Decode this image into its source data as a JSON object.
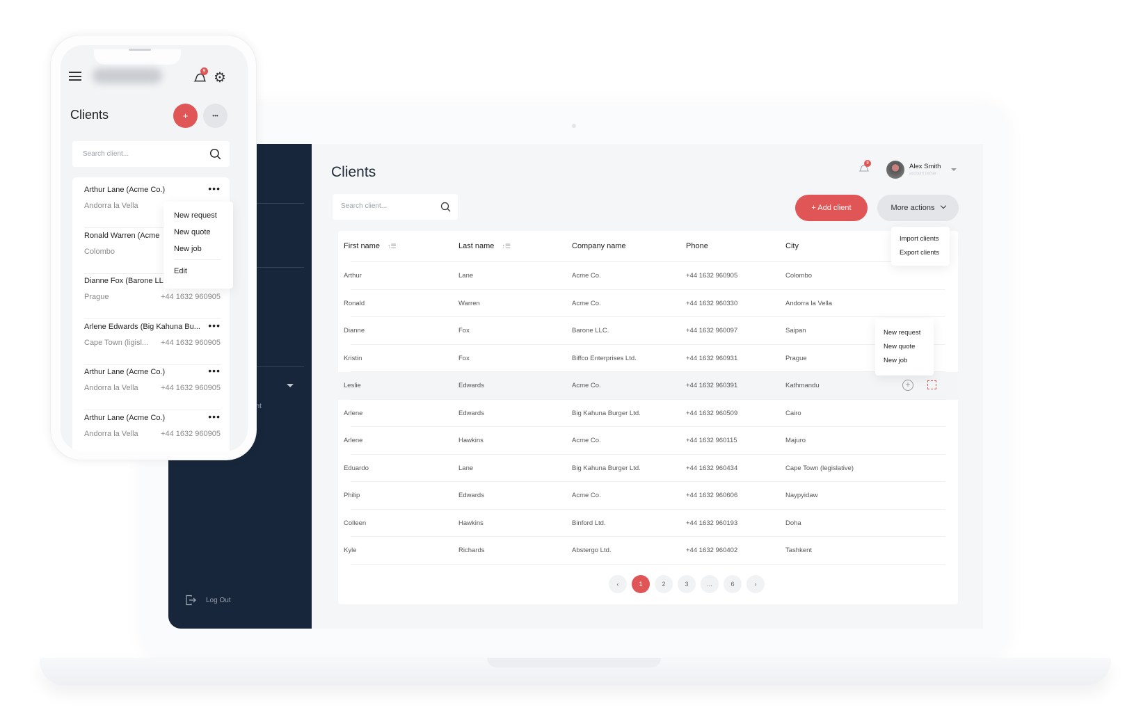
{
  "phone": {
    "notification_count": "9",
    "title": "Clients",
    "add_label": "+",
    "more_label": "•••",
    "search_placeholder": "Search client...",
    "items": [
      {
        "name": "Arthur Lane (Acme Co.)",
        "city": "Andorra la Vella",
        "phone": ""
      },
      {
        "name": "Ronald Warren (Acme",
        "city": "Colombo",
        "phone": ""
      },
      {
        "name": "Dianne Fox (Barone LL",
        "city": "Prague",
        "phone": "+44 1632 960905"
      },
      {
        "name": "Arlene Edwards (Big Kahuna Bu...",
        "city": "Cape Town (ligisl...",
        "phone": "+44 1632 960905"
      },
      {
        "name": "Arthur Lane (Acme Co.)",
        "city": "Andorra la Vella",
        "phone": "+44 1632 960905"
      },
      {
        "name": "Arthur Lane (Acme Co.)",
        "city": "Andorra la Vella",
        "phone": "+44 1632 960905"
      }
    ],
    "menu": {
      "new_request": "New request",
      "new_quote": "New quote",
      "new_job": "New job",
      "edit": "Edit"
    }
  },
  "sidebar": {
    "partial_item": "ent",
    "logout": "Log Out"
  },
  "header": {
    "title": "Clients",
    "notification_count": "9",
    "user_name": "Alex Smith",
    "user_role": "account owner"
  },
  "toolbar": {
    "search_placeholder": "Search client...",
    "add_client": "+ Add client",
    "more_actions": "More actions",
    "more_menu": {
      "import": "Import clients",
      "export": "Export clients"
    }
  },
  "table": {
    "columns": [
      "First name",
      "Last name",
      "Company name",
      "Phone",
      "City"
    ],
    "rows": [
      [
        "Arthur",
        "Lane",
        "Acme Co.",
        "+44 1632 960905",
        "Colombo"
      ],
      [
        "Ronald",
        "Warren",
        "Acme Co.",
        "+44 1632 960330",
        "Andorra la Vella"
      ],
      [
        "Dianne",
        "Fox",
        "Barone LLC.",
        "+44 1632 960097",
        "Saipan"
      ],
      [
        "Kristin",
        "Fox",
        "Biffco Enterprises Ltd.",
        "+44 1632 960931",
        "Prague"
      ],
      [
        "Leslie",
        "Edwards",
        "Acme Co.",
        "+44 1632 960391",
        "Kathmandu"
      ],
      [
        "Arlene",
        "Edwards",
        "Big Kahuna Burger Ltd.",
        "+44 1632 960509",
        "Cairo"
      ],
      [
        "Arlene",
        "Hawkins",
        "Acme Co.",
        "+44 1632 960115",
        "Majuro"
      ],
      [
        "Eduardo",
        "Lane",
        "Big Kahuna Burger Ltd.",
        "+44 1632 960434",
        "Cape Town (legislative)"
      ],
      [
        "Philip",
        "Edwards",
        "Acme Co.",
        "+44 1632 960606",
        "Naypyidaw"
      ],
      [
        "Colleen",
        "Hawkins",
        "Binford Ltd.",
        "+44 1632 960193",
        "Doha"
      ],
      [
        "Kyle",
        "Richards",
        "Abstergo Ltd.",
        "+44 1632 960402",
        "Tashkent"
      ]
    ],
    "hovered_row": 4,
    "row_menu": {
      "new_request": "New request",
      "new_quote": "New quote",
      "new_job": "New job"
    }
  },
  "pagination": {
    "prev": "‹",
    "pages": [
      "1",
      "2",
      "3",
      "...",
      "6"
    ],
    "next": "›",
    "current": "1"
  },
  "colors": {
    "accent": "#e05656",
    "sidebar": "#17263a",
    "background": "#f5f6f8"
  }
}
